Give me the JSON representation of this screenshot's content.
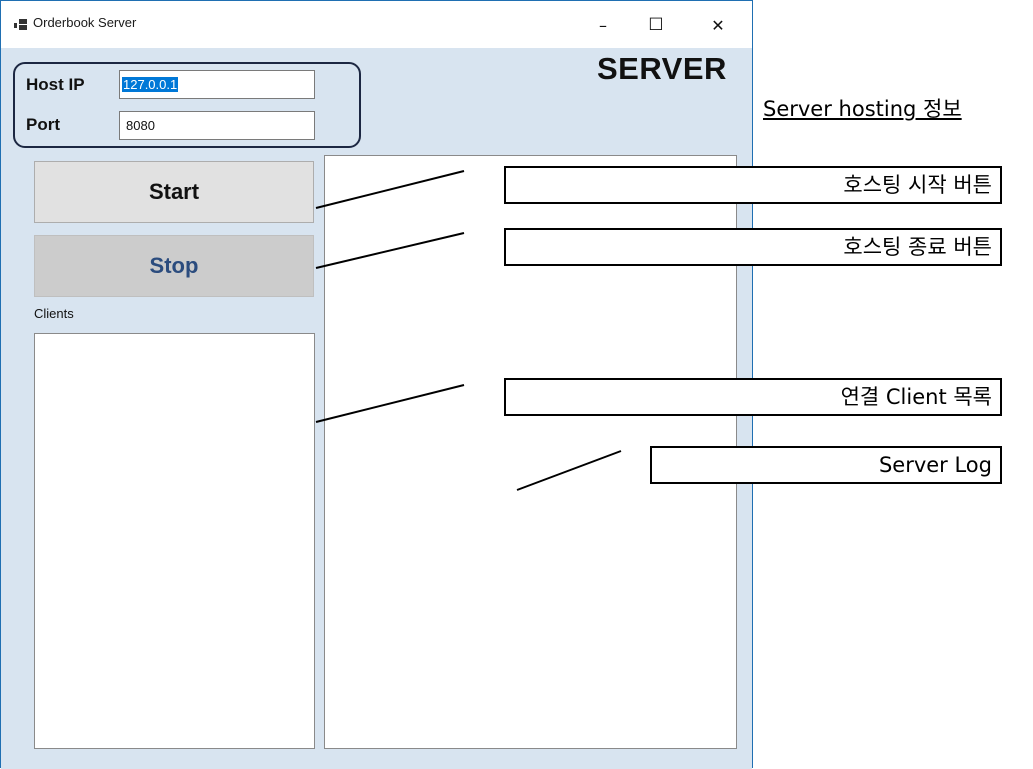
{
  "window": {
    "title": "Orderbook Server",
    "controls": {
      "minimize": "–",
      "maximize": "☐",
      "close": "✕"
    }
  },
  "header": {
    "title": "SERVER"
  },
  "host": {
    "ip_label": "Host IP",
    "ip_value": "127.0.0.1",
    "port_label": "Port",
    "port_value": "8080"
  },
  "buttons": {
    "start": "Start",
    "stop": "Stop"
  },
  "clients": {
    "label": "Clients"
  },
  "annotations": {
    "server_hosting": "Server hosting 정보",
    "start_button": "호스팅 시작 버튼",
    "stop_button": "호스팅 종료 버튼",
    "client_list": "연결 Client 목록",
    "server_log": "Server Log"
  },
  "colors": {
    "client_bg": "#d8e4f0",
    "selection": "#0078d7",
    "stop_text": "#2b4c7e",
    "window_border": "#1f6fb2"
  },
  "icons": [
    "app-icon",
    "minimize-icon",
    "maximize-icon",
    "close-icon"
  ]
}
